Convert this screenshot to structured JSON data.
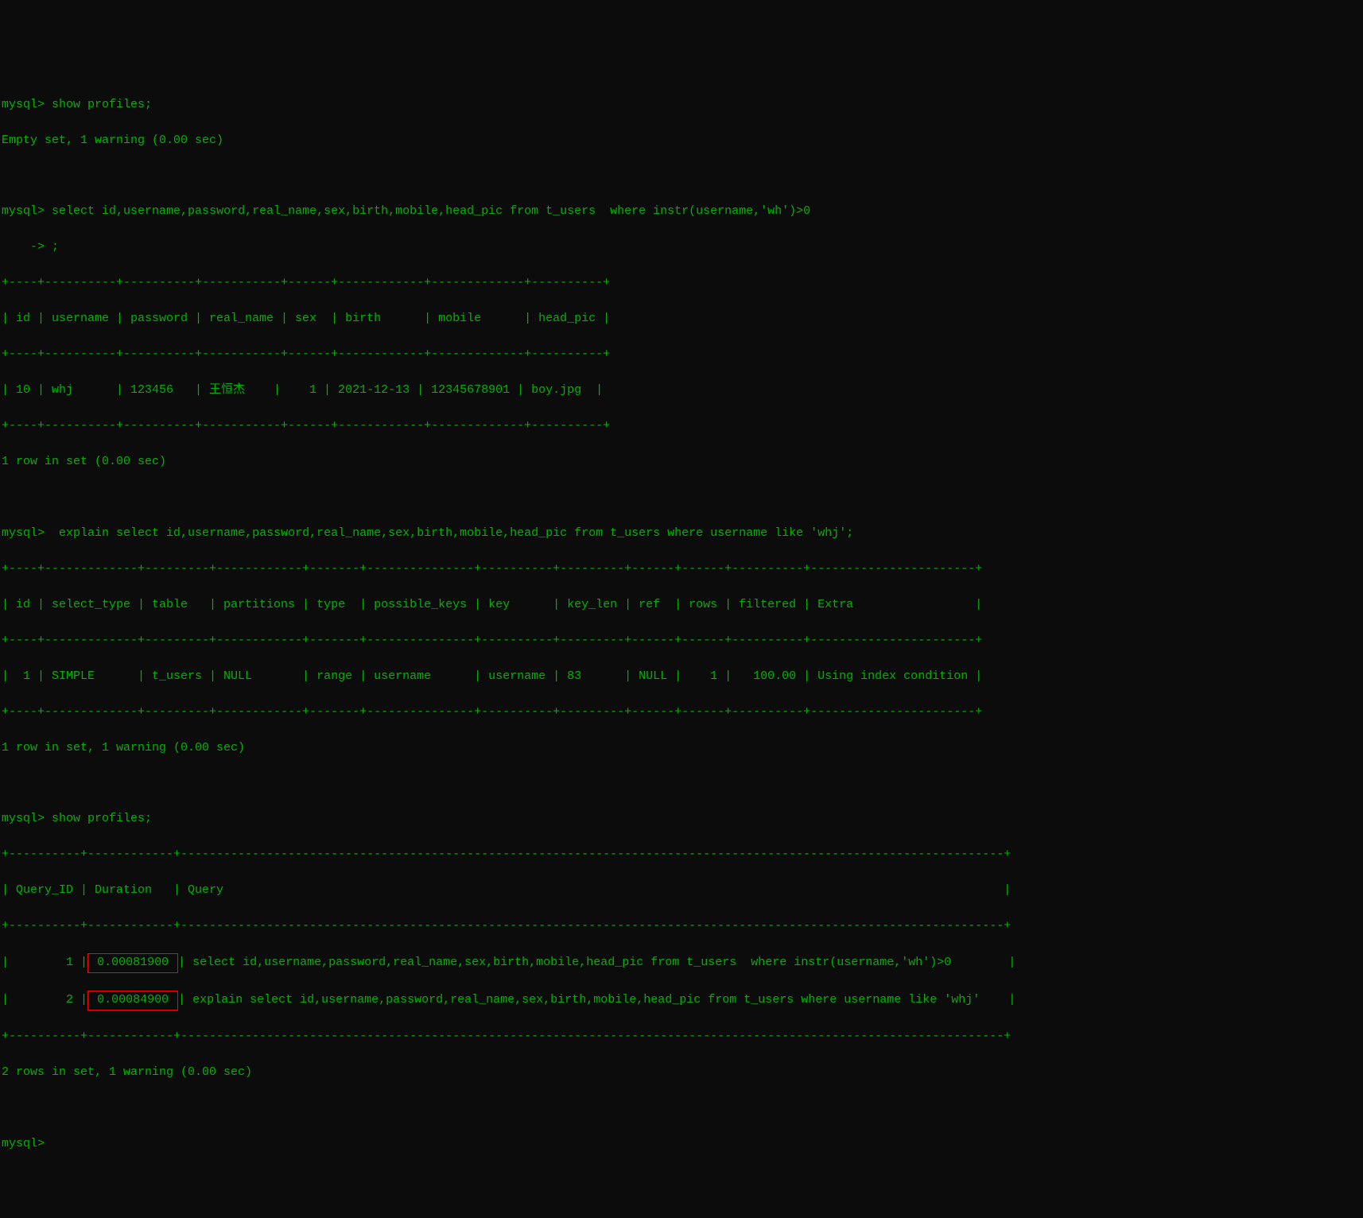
{
  "prompt": "mysql>",
  "continuation_prompt": "    ->",
  "commands": {
    "show_profiles_1": "show profiles;",
    "show_profiles_1_result": "Empty set, 1 warning (0.00 sec)",
    "select_query": "select id,username,password,real_name,sex,birth,mobile,head_pic from t_users  where instr(username,'wh')>0",
    "continuation": ";",
    "table1_border_top": "+----+----------+----------+-----------+------+------------+-------------+----------+",
    "table1_header": "| id | username | password | real_name | sex  | birth      | mobile      | head_pic |",
    "table1_border_mid": "+----+----------+----------+-----------+------+------------+-------------+----------+",
    "table1_row1": "| 10 | whj      | 123456   | 王恒杰    |    1 | 2021-12-13 | 12345678901 | boy.jpg  |",
    "table1_border_bot": "+----+----------+----------+-----------+------+------------+-------------+----------+",
    "table1_result": "1 row in set (0.00 sec)",
    "explain_query": " explain select id,username,password,real_name,sex,birth,mobile,head_pic from t_users where username like 'whj';",
    "table2_border_top": "+----+-------------+---------+------------+-------+---------------+----------+---------+------+------+----------+-----------------------+",
    "table2_header": "| id | select_type | table   | partitions | type  | possible_keys | key      | key_len | ref  | rows | filtered | Extra                 |",
    "table2_border_mid": "+----+-------------+---------+------------+-------+---------------+----------+---------+------+------+----------+-----------------------+",
    "table2_row1": "|  1 | SIMPLE      | t_users | NULL       | range | username      | username | 83      | NULL |    1 |   100.00 | Using index condition |",
    "table2_border_bot": "+----+-------------+---------+------------+-------+---------------+----------+---------+------+------+----------+-----------------------+",
    "table2_result": "1 row in set, 1 warning (0.00 sec)",
    "show_profiles_2": "show profiles;",
    "table3_border_top": "+----------+------------+-------------------------------------------------------------------------------------------------------------------+",
    "table3_header": "| Query_ID | Duration   | Query                                                                                                             |",
    "table3_border_mid": "+----------+------------+-------------------------------------------------------------------------------------------------------------------+",
    "table3_row1_qid": "        1",
    "table3_row1_dur": "0.00081900",
    "table3_row1_query": "select id,username,password,real_name,sex,birth,mobile,head_pic from t_users  where instr(username,'wh')>0       ",
    "table3_row2_qid": "        2",
    "table3_row2_dur": "0.00084900",
    "table3_row2_query": "explain select id,username,password,real_name,sex,birth,mobile,head_pic from t_users where username like 'whj'   ",
    "table3_border_bot": "+----------+------------+-------------------------------------------------------------------------------------------------------------------+",
    "table3_result": "2 rows in set, 1 warning (0.00 sec)"
  }
}
